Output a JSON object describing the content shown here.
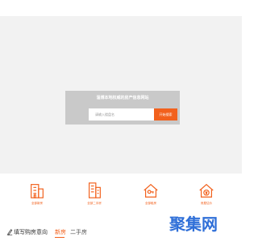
{
  "colors": {
    "accent": "#f2611d",
    "hero_background": "#f2f2f2",
    "panel_background": "#c9c9c9",
    "watermark": "#2f6fd8"
  },
  "search": {
    "title": "淄博本地权威的房产信息网站",
    "placeholder": "请输入楼盘名",
    "button_label": "开始搜索"
  },
  "services": [
    {
      "icon": "apartment-building-icon",
      "label": "全部新房"
    },
    {
      "icon": "office-tower-icon",
      "label": "全部二手房"
    },
    {
      "icon": "house-key-icon",
      "label": "全部租房"
    },
    {
      "icon": "house-price-icon",
      "label": "房屋估价"
    }
  ],
  "intent": {
    "icon": "edit-icon",
    "title": "填写购房意向"
  },
  "tabs": [
    {
      "label": "新房",
      "active": true
    },
    {
      "label": "二手房",
      "active": false
    }
  ],
  "watermark": {
    "text": "聚集网"
  }
}
